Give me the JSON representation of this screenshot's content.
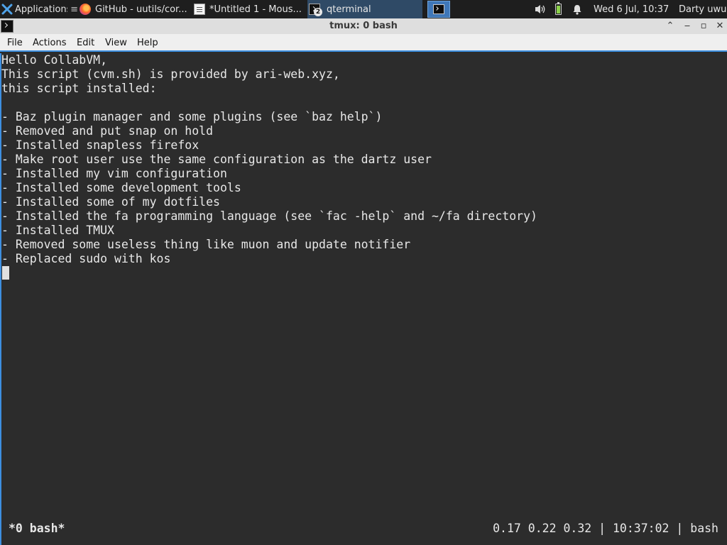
{
  "panel": {
    "applications_label": "Applications",
    "tasks": [
      {
        "label": "GitHub - uutils/cor...",
        "icon": "firefox-icon"
      },
      {
        "label": "*Untitled 1 - Mous...",
        "icon": "text-editor-icon"
      },
      {
        "label": "qterminal",
        "icon": "terminal-icon",
        "badge": "2",
        "active": true
      }
    ],
    "clock": "Wed  6 Jul, 10:37",
    "user": "Darty uwu"
  },
  "window": {
    "title": "tmux: 0 bash",
    "controls": {
      "shade": "⌃",
      "minimize": "‒",
      "maximize": "▫",
      "close": "✕"
    }
  },
  "menu": [
    "File",
    "Actions",
    "Edit",
    "View",
    "Help"
  ],
  "terminal": {
    "lines": [
      "Hello CollabVM,",
      "This script (cvm.sh) is provided by ari-web.xyz,",
      "this script installed:",
      "",
      "- Baz plugin manager and some plugins (see `baz help`)",
      "- Removed and put snap on hold",
      "- Installed snapless firefox",
      "- Make root user use the same configuration as the dartz user",
      "- Installed my vim configuration",
      "- Installed some development tools",
      "- Installed some of my dotfiles",
      "- Installed the fa programming language (see `fac -help` and ~/fa directory)",
      "- Installed TMUX",
      "- Removed some useless thing like muon and update notifier",
      "- Replaced sudo with kos"
    ],
    "status_left": "*0 bash*",
    "status_right": "0.17 0.22 0.32 | 10:37:02 | bash"
  },
  "colors": {
    "panel_bg": "#1e1e1e",
    "active_task": "#2f4a66",
    "accent": "#3d8fe0",
    "terminal_bg": "#2c2c2c",
    "terminal_fg": "#e8e8e8"
  }
}
